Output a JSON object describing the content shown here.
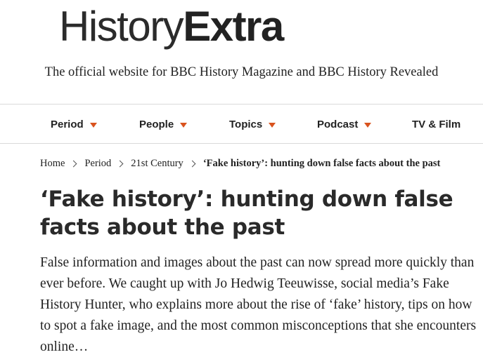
{
  "header": {
    "logo_light": "History",
    "logo_bold": "Extra",
    "tagline": "The official website for BBC History Magazine and BBC History Revealed"
  },
  "nav": {
    "items": [
      {
        "label": "Period",
        "dropdown": true
      },
      {
        "label": "People",
        "dropdown": true
      },
      {
        "label": "Topics",
        "dropdown": true
      },
      {
        "label": "Podcast",
        "dropdown": true
      },
      {
        "label": "TV & Film",
        "dropdown": false
      }
    ]
  },
  "breadcrumb": {
    "items": [
      "Home",
      "Period",
      "21st Century"
    ],
    "current": "‘Fake history’: hunting down false facts about the past"
  },
  "article": {
    "title": "‘Fake history’: hunting down false facts about the past",
    "standfirst": "False information and images about the past can now spread more quickly than ever before. We caught up with Jo Hedwig Teeuwisse, social media’s Fake History Hunter, who explains more about the rise of ‘fake’ history, tips on how to spot a fake image, and the most common misconceptions that she encounters online…"
  },
  "colors": {
    "accent": "#d9531e",
    "text": "#222222",
    "divider": "#d9d9d9"
  }
}
